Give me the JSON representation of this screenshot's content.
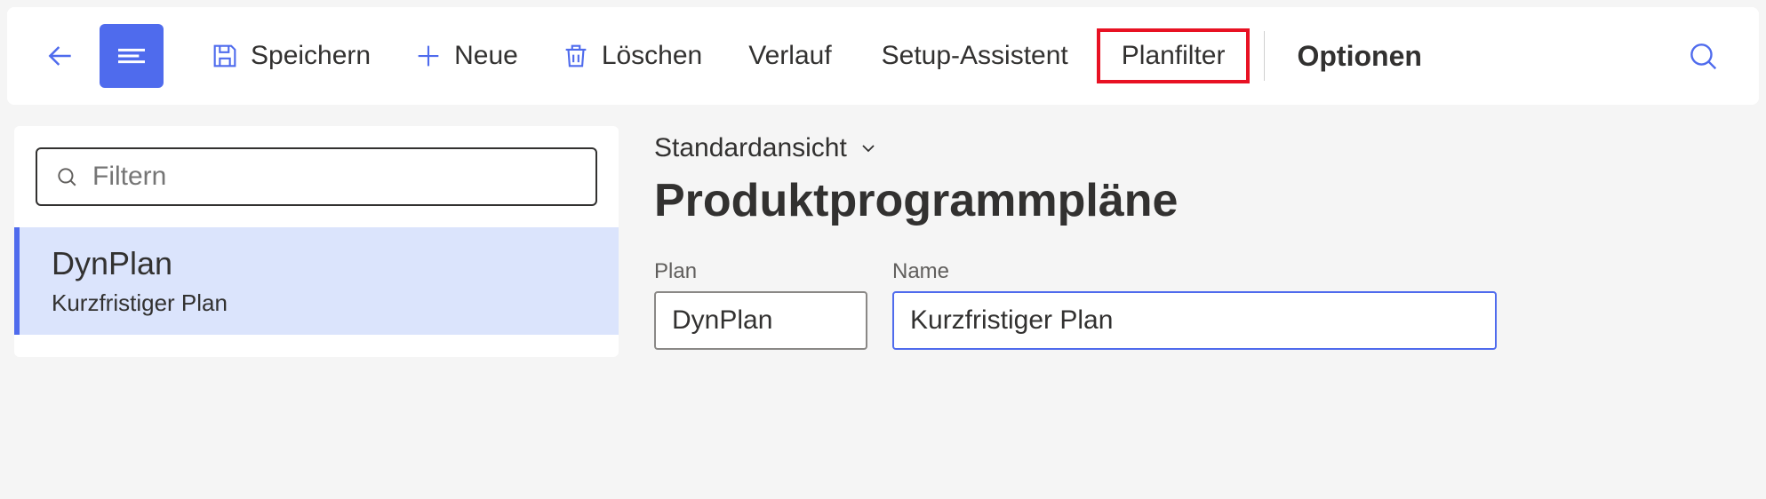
{
  "toolbar": {
    "save_label": "Speichern",
    "new_label": "Neue",
    "delete_label": "Löschen",
    "history_label": "Verlauf",
    "setup_label": "Setup-Assistent",
    "planfilter_label": "Planfilter",
    "options_label": "Optionen"
  },
  "sidebar": {
    "filter_placeholder": "Filtern",
    "items": [
      {
        "title": "DynPlan",
        "subtitle": "Kurzfristiger Plan"
      }
    ]
  },
  "main": {
    "view_selector": "Standardansicht",
    "page_title": "Produktprogrammpläne",
    "fields": {
      "plan_label": "Plan",
      "plan_value": "DynPlan",
      "name_label": "Name",
      "name_value": "Kurzfristiger Plan"
    }
  }
}
